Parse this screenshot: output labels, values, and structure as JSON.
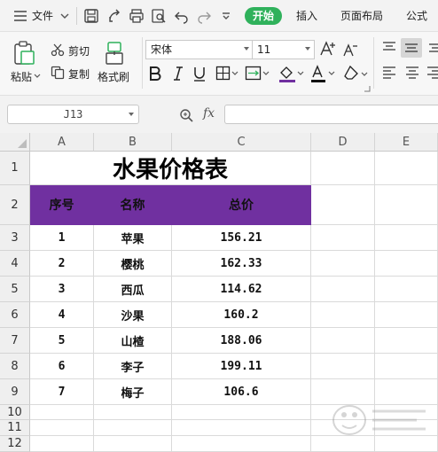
{
  "menubar": {
    "file_label": "文件",
    "tabs": [
      "开始",
      "插入",
      "页面布局",
      "公式"
    ]
  },
  "ribbon": {
    "paste_label": "粘贴",
    "cut_label": "剪切",
    "copy_label": "复制",
    "format_painter_label": "格式刷",
    "font_name": "宋体",
    "font_size": "11"
  },
  "formula_bar": {
    "cell_ref": "J13",
    "fx_label": "fx",
    "formula_value": ""
  },
  "sheet": {
    "columns": [
      "A",
      "B",
      "C",
      "D",
      "E"
    ],
    "rows": [
      "1",
      "2",
      "3",
      "4",
      "5",
      "6",
      "7",
      "8",
      "9",
      "10",
      "11",
      "12"
    ],
    "title": "水果价格表",
    "headers": [
      "序号",
      "名称",
      "总价"
    ],
    "records": [
      [
        "1",
        "苹果",
        "156.21"
      ],
      [
        "2",
        "樱桃",
        "162.33"
      ],
      [
        "3",
        "西瓜",
        "114.62"
      ],
      [
        "4",
        "沙果",
        "160.2"
      ],
      [
        "5",
        "山楂",
        "188.06"
      ],
      [
        "6",
        "李子",
        "199.11"
      ],
      [
        "7",
        "梅子",
        "106.6"
      ]
    ],
    "header_fill_color": "#7030a0"
  },
  "colors": {
    "active_tab": "#2fb15b",
    "header_fill": "#7030a0"
  }
}
